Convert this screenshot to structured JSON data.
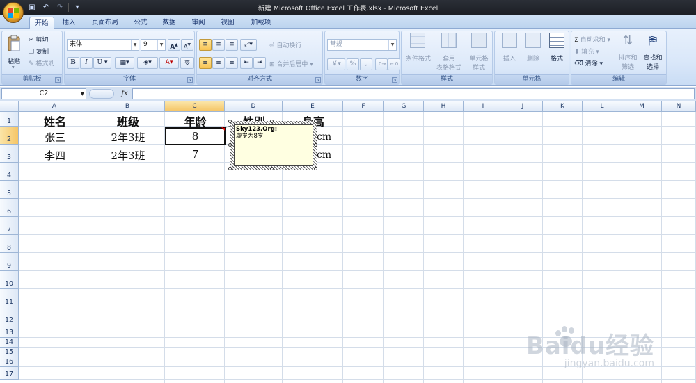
{
  "window": {
    "title": "新建 Microsoft Office Excel 工作表.xlsx - Microsoft Excel"
  },
  "tabs": [
    {
      "label": "开始",
      "active": true
    },
    {
      "label": "插入"
    },
    {
      "label": "页面布局"
    },
    {
      "label": "公式"
    },
    {
      "label": "数据"
    },
    {
      "label": "审阅"
    },
    {
      "label": "视图"
    },
    {
      "label": "加载项"
    }
  ],
  "ribbon": {
    "clipboard": {
      "label": "剪贴板",
      "paste": "粘贴",
      "cut": "剪切",
      "copy": "复制",
      "format_painter": "格式刷"
    },
    "font": {
      "label": "字体",
      "font_name": "宋体",
      "font_size": "9",
      "bold": "B",
      "italic": "I",
      "underline": "U",
      "grow": "A",
      "shrink": "A"
    },
    "alignment": {
      "label": "对齐方式",
      "wrap": "自动换行",
      "merge": "合并后居中"
    },
    "number": {
      "label": "数字",
      "format": "常规",
      "percent": "%",
      "comma": ","
    },
    "styles": {
      "label": "样式",
      "conditional": "条件格式",
      "table_format_1": "套用",
      "table_format_2": "表格格式",
      "cell_styles_1": "单元格",
      "cell_styles_2": "样式"
    },
    "cells": {
      "label": "单元格",
      "insert": "插入",
      "delete": "删除",
      "format": "格式"
    },
    "editing": {
      "label": "编辑",
      "autosum": "自动求和",
      "fill": "填充",
      "clear": "清除",
      "sort_1": "排序和",
      "sort_2": "筛选",
      "find_1": "查找和",
      "find_2": "选择"
    }
  },
  "formula_bar": {
    "name_box": "C2",
    "fx": "fx",
    "value": ""
  },
  "columns": [
    "A",
    "B",
    "C",
    "D",
    "E",
    "F",
    "G",
    "H",
    "I",
    "J",
    "K",
    "L",
    "M",
    "N"
  ],
  "rows": [
    "1",
    "2",
    "3",
    "4",
    "5",
    "6",
    "7",
    "8",
    "9",
    "10",
    "11",
    "12",
    "13",
    "14",
    "15",
    "16",
    "17"
  ],
  "cells": {
    "A1": "姓名",
    "B1": "班级",
    "C1": "年龄",
    "D1": "性别",
    "E1": "身高",
    "A2": "张三",
    "B2": "2年3班",
    "C2": "8",
    "E2": "cm",
    "A3": "李四",
    "B3": "2年3班",
    "C3": "7",
    "E3": "cm"
  },
  "comment": {
    "author": "Sky123.Org:",
    "text": "虚岁为8岁"
  },
  "watermark": {
    "brand": "Bai",
    "brand_mid": "du",
    "brand_cn": "经验",
    "url": "jingyan.baidu.com"
  }
}
